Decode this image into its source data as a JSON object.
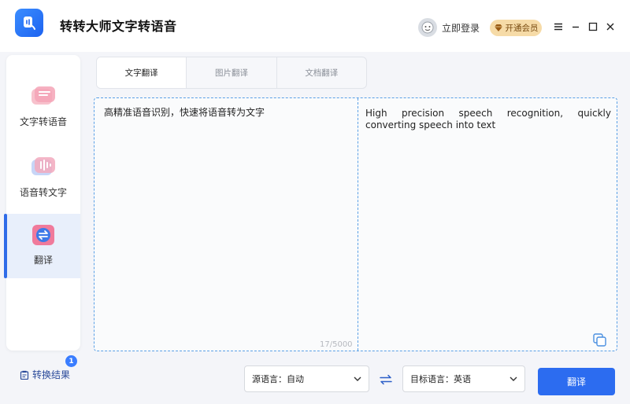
{
  "app": {
    "title": "转转大师文字转语音",
    "logo_icon": "app-logo-icon"
  },
  "header": {
    "login_label": "立即登录",
    "vip_label": "开通会员",
    "menu_icon": "menu-icon",
    "minimize_icon": "minimize-icon",
    "maximize_icon": "maximize-icon",
    "close_icon": "close-icon"
  },
  "sidebar": {
    "items": [
      {
        "label": "文字转语音",
        "icon": "text-to-speech-icon",
        "active": false
      },
      {
        "label": "语音转文字",
        "icon": "speech-to-text-icon",
        "active": false
      },
      {
        "label": "翻译",
        "icon": "translate-icon",
        "active": true
      }
    ],
    "results_label": "转换结果",
    "results_count": "1"
  },
  "tabs": [
    {
      "label": "文字翻译",
      "active": true
    },
    {
      "label": "图片翻译",
      "active": false
    },
    {
      "label": "文档翻译",
      "active": false
    }
  ],
  "editor": {
    "source_text": "高精准语音识别，快速将语音转为文字",
    "char_count": "17/5000",
    "target_text": "High precision speech recognition, quickly converting speech into text"
  },
  "controls": {
    "source_language": "源语言：自动",
    "target_language": "目标语言：英语",
    "translate_label": "翻译"
  },
  "colors": {
    "accent": "#2c6cf0",
    "sidebar_active": "#e8effb",
    "vip_bg": "#f6dba7",
    "editor_border": "#5aa0e6"
  }
}
